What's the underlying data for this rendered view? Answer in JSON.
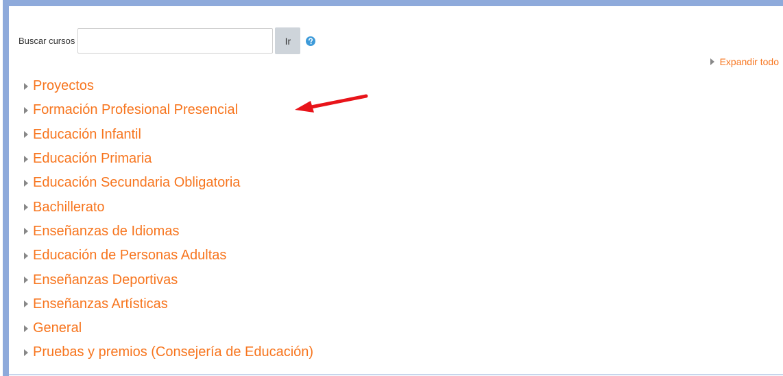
{
  "search": {
    "label": "Buscar cursos",
    "value": "",
    "placeholder": "",
    "button_label": "Ir"
  },
  "expand_all_label": "Expandir todo",
  "categories": [
    {
      "label": "Proyectos"
    },
    {
      "label": "Formación Profesional Presencial"
    },
    {
      "label": "Educación Infantil"
    },
    {
      "label": "Educación Primaria"
    },
    {
      "label": "Educación Secundaria Obligatoria"
    },
    {
      "label": "Bachillerato"
    },
    {
      "label": "Enseñanzas de Idiomas"
    },
    {
      "label": "Educación de Personas Adultas"
    },
    {
      "label": "Enseñanzas Deportivas"
    },
    {
      "label": "Enseñanzas Artísticas"
    },
    {
      "label": "General"
    },
    {
      "label": "Pruebas y premios (Consejería de Educación)"
    }
  ],
  "icons": {
    "help": "question-circle-icon",
    "collapsed": "caret-right-icon",
    "annotation": "red-arrow-annotation"
  },
  "colors": {
    "link": "#f7751e",
    "frame": "#8eaadb",
    "button_bg": "#ced4da",
    "help_icon": "#3d9ad9",
    "arrow": "#e8141a"
  }
}
